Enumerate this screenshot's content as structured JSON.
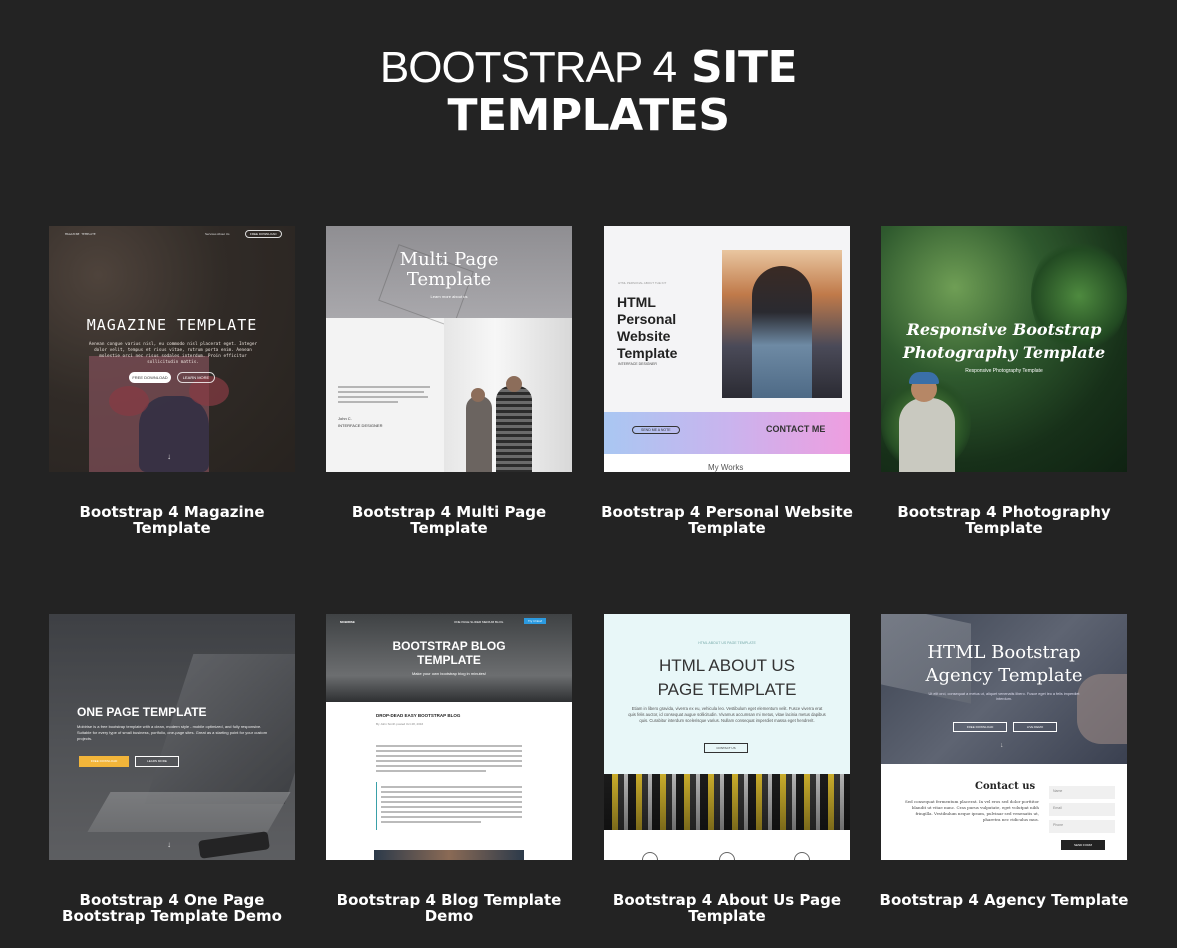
{
  "heading": {
    "light": "BOOTSTRAP 4",
    "bold_line1": "SITE",
    "bold_line2": "TEMPLATES"
  },
  "cards": [
    {
      "caption_line1": "Bootstrap 4 Magazine",
      "caption_line2": "Template",
      "thumb": {
        "title": "MAGAZINE TEMPLATE",
        "nav_brand": "MAGAZINE TEMPLATE",
        "nav_links": "Services  About Us",
        "nav_btn": "FREE DOWNLOAD",
        "body": "Aenean congue varius nisl, eu commodo nisl placerat eget. Integer dolor velit, tempus et risus vitae, rutrum porta enim. Aenean molestie orci nec risus sodales interdum. Proin efficitur sollicitudin mattis.",
        "btn1": "FREE DOWNLOAD",
        "btn2": "LEARN MORE"
      }
    },
    {
      "caption_line1": "Bootstrap 4 Multi Page",
      "caption_line2": "Template",
      "thumb": {
        "title_line1": "Multi Page",
        "title_line2": "Template",
        "sub": "Learn more about us",
        "name": "John C.",
        "role": "INTERFACE DESIGNER"
      }
    },
    {
      "caption_line1": "Bootstrap 4 Personal Website",
      "caption_line2": "Template",
      "thumb": {
        "kicker": "HTML PERSONAL ABOUT THE KIT",
        "title_line1": "HTML",
        "title_line2": "Personal",
        "title_line3": "Website",
        "title_line4": "Template",
        "role": "INTERFACE DESIGNER",
        "btn": "SEND ME A NOTE",
        "contact": "CONTACT ME",
        "works": "My Works"
      }
    },
    {
      "caption_line1": "Bootstrap 4 Photography",
      "caption_line2": "Template",
      "thumb": {
        "title_line1": "Responsive Bootstrap",
        "title_line2": "Photography Template",
        "sub": "Responsive Photography Template"
      }
    },
    {
      "caption_line1": "Bootstrap 4 One Page",
      "caption_line2": "Bootstrap Template Demo",
      "thumb": {
        "title": "ONE PAGE TEMPLATE",
        "body": "Mobirise is a free bootstrap template with a clean, modern style - mobile optimized, and fully responsive. Suitable for every type of small business, portfolio, one-page sites. Great as a starting point for your custom projects.",
        "btn1": "FREE DOWNLOAD",
        "btn2": "LEARN MORE"
      }
    },
    {
      "caption_line1": "Bootstrap 4 Blog Template",
      "caption_line2": "Demo",
      "thumb": {
        "nav_brand": "MOBIRISE",
        "nav_links": "ONE PAGE  SLIDER  MEDIUM  BLOG",
        "nav_btn": "Try it Now!",
        "title_line1": "BOOTSTRAP BLOG",
        "title_line2": "TEMPLATE",
        "sub": "Make your own bootstrap blog in minutes!",
        "post_title": "DROP-DEAD EASY BOOTSTRAP BLOG",
        "meta": "By John Smith posted Oct 28, 2016"
      }
    },
    {
      "caption_line1": "Bootstrap 4 About Us Page",
      "caption_line2": "Template",
      "thumb": {
        "kicker": "HTML ABOUT US PAGE TEMPLATE",
        "title_line1": "HTML ABOUT US",
        "title_line2": "PAGE TEMPLATE",
        "body": "Etiam in libero gravida, viverra ex eu, vehicula leo. Vestibulum eget elementum velit. Fusce viverra erat quis felis auctor, id consequat augue sollicitudin. Vivamus accumsan mi metus, vitae lacinia metus dapibus quis. Curabitur interdum scelerisque varius. Nullam consequat imperdiet massa eget hendrerit.",
        "btn": "CONTACT US"
      }
    },
    {
      "caption_line1": "Bootstrap 4 Agency Template",
      "caption_line2": "",
      "thumb": {
        "title_line1": "HTML Bootstrap",
        "title_line2": "Agency Template",
        "sub": "Ut elit orci, consequat a metus ut, aliquet venenatis libero. Fusce eget leo a felis imperdiet interdum.",
        "btn1": "FREE DOWNLOAD",
        "btn2": "LIVE DEMO",
        "contact": "Contact us",
        "contact_body": "Sed consequat fermentum placerat. In vel eros sed dolor porttitor blandit ut vitae nunc. Cras purus vulputate, eget volutpat nibh fringilla. Vestibulum neque ipsum, pulvinar sed venenatis ut, pharetra nec ridiculus mus.",
        "f1": "Name",
        "f2": "Email",
        "f3": "Phone",
        "btn3": "SEND FORM"
      }
    }
  ]
}
